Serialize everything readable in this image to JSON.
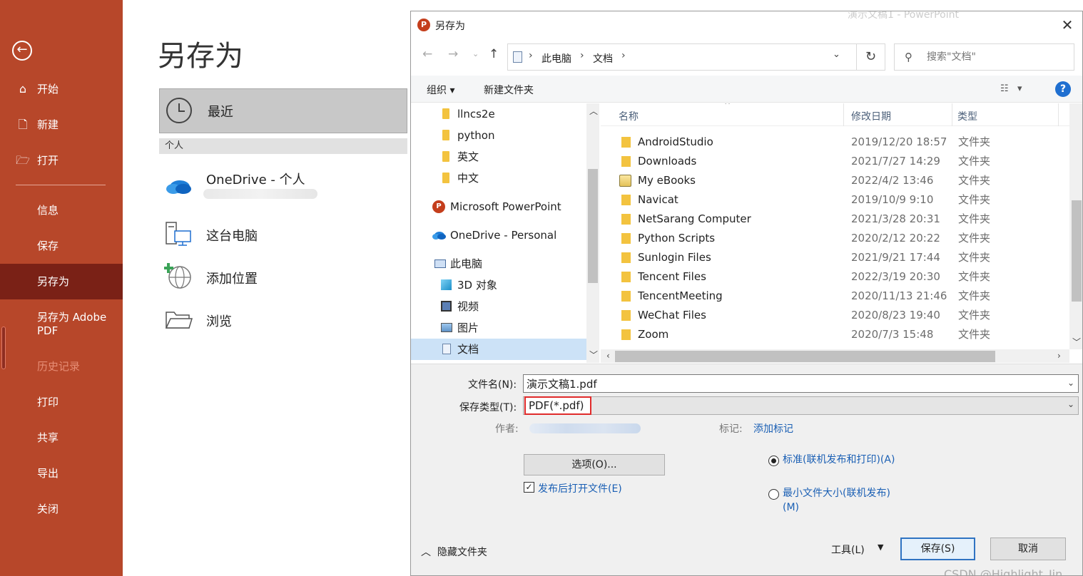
{
  "nav": {
    "items": {
      "home": "开始",
      "new": "新建",
      "open": "打开",
      "info": "信息",
      "save": "保存",
      "saveas": "另存为",
      "saveas_pdf": "另存为 Adobe PDF",
      "history": "历史记录",
      "print": "打印",
      "share": "共享",
      "export": "导出",
      "close": "关闭"
    },
    "icons": {
      "back": "back-arrow-icon",
      "home": "home-icon",
      "new": "new-document-icon",
      "open": "open-folder-icon"
    }
  },
  "backstage": {
    "title": "另存为",
    "recent_label": "最近",
    "personal_header": "个人",
    "onedrive_label": "OneDrive - 个人",
    "this_pc_label": "这台电脑",
    "add_place_label": "添加位置",
    "browse_label": "浏览"
  },
  "window_title_bg": "演示文稿1 - PowerPoint",
  "dialog": {
    "title": "另存为",
    "close_glyph": "✕",
    "breadcrumb": [
      "此电脑",
      "文档"
    ],
    "search_placeholder": "搜索\"文档\"",
    "toolbar": {
      "organize": "组织 ▾",
      "new_folder": "新建文件夹",
      "help": "?"
    },
    "tree": {
      "llncs2e": "llncs2e",
      "python": "python",
      "english": "英文",
      "chinese": "中文",
      "powerpoint": "Microsoft PowerPoint",
      "onedrive": "OneDrive - Personal",
      "this_pc": "此电脑",
      "objects3d": "3D 对象",
      "videos": "视频",
      "pictures": "图片",
      "documents": "文档"
    },
    "columns": {
      "name": "名称",
      "modified": "修改日期",
      "type": "类型"
    },
    "files": [
      {
        "name": "AndroidStudio",
        "date": "2019/12/20 18:57",
        "type": "文件夹"
      },
      {
        "name": "Downloads",
        "date": "2021/7/27 14:29",
        "type": "文件夹"
      },
      {
        "name": "My eBooks",
        "date": "2022/4/2 13:46",
        "type": "文件夹"
      },
      {
        "name": "Navicat",
        "date": "2019/10/9 9:10",
        "type": "文件夹"
      },
      {
        "name": "NetSarang Computer",
        "date": "2021/3/28 20:31",
        "type": "文件夹"
      },
      {
        "name": "Python Scripts",
        "date": "2020/2/12 20:22",
        "type": "文件夹"
      },
      {
        "name": "Sunlogin Files",
        "date": "2021/9/21 17:44",
        "type": "文件夹"
      },
      {
        "name": "Tencent Files",
        "date": "2022/3/19 20:30",
        "type": "文件夹"
      },
      {
        "name": "TencentMeeting",
        "date": "2020/11/13 21:46",
        "type": "文件夹"
      },
      {
        "name": "WeChat Files",
        "date": "2020/8/23 19:40",
        "type": "文件夹"
      },
      {
        "name": "Zoom",
        "date": "2020/7/3 15:48",
        "type": "文件夹"
      }
    ],
    "form": {
      "filename_label": "文件名(N):",
      "filename_value": "演示文稿1.pdf",
      "filetype_label": "保存类型(T):",
      "filetype_value": "PDF(*.pdf)",
      "author_label": "作者:",
      "tags_label": "标记:",
      "tags_add": "添加标记",
      "options_button": "选项(O)...",
      "open_after_publish": "发布后打开文件(E)",
      "radio_standard": "标准(联机发布和打印)(A)",
      "radio_min": "最小文件大小(联机发布)(M)",
      "hide_folders": "隐藏文件夹",
      "tools": "工具(L)",
      "save": "保存(S)",
      "cancel": "取消"
    },
    "watermark": "CSDN @Highlight_Jin"
  },
  "colors": {
    "accent": "#b7472a",
    "accent_dark": "#7a2116",
    "link": "#1a5fb4",
    "folder": "#f3c33f",
    "highlight_box": "#e02b2b"
  }
}
